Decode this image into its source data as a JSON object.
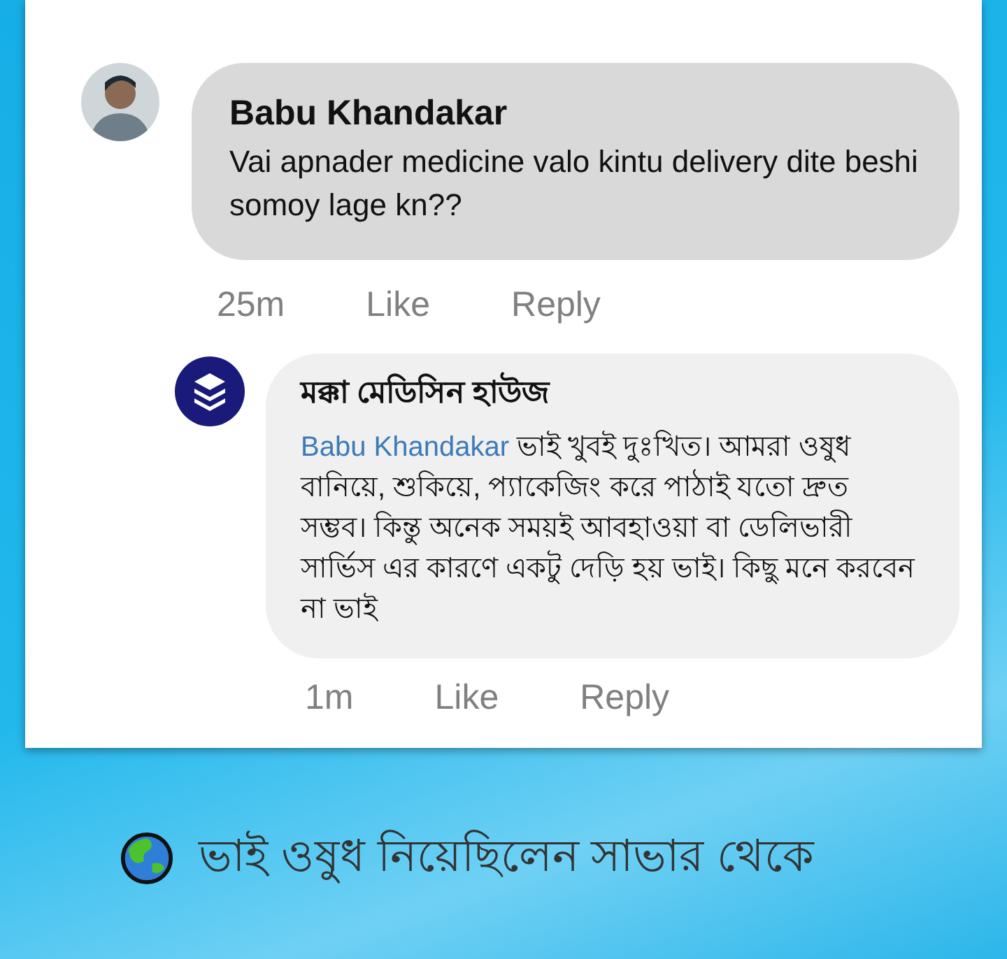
{
  "comments": [
    {
      "kind": "post",
      "author": "Babu Khandakar",
      "text": "Vai apnader medicine valo kintu delivery dite beshi somoy lage kn??",
      "time": "25m",
      "actions": [
        "Like",
        "Reply"
      ]
    },
    {
      "kind": "reply",
      "author": "মক্কা মেডিসিন হাউজ",
      "mention": "Babu Khandakar",
      "text": "ভাই খুবই দুঃখিত। আমরা ওষুধ বানিয়ে, শুকিয়ে, প্যাকেজিং করে পাঠাই যতো দ্রুত সম্ভব। কিন্তু অনেক সময়ই আবহাওয়া বা ডেলিভারী সার্ভিস এর কারণে একটু দেড়ি হয় ভাই। কিছু মনে করবেন না ভাই",
      "time": "1m",
      "actions": [
        "Like",
        "Reply"
      ]
    }
  ],
  "caption": "ভাই ওষুধ নিয়েছিলেন সাভার থেকে"
}
